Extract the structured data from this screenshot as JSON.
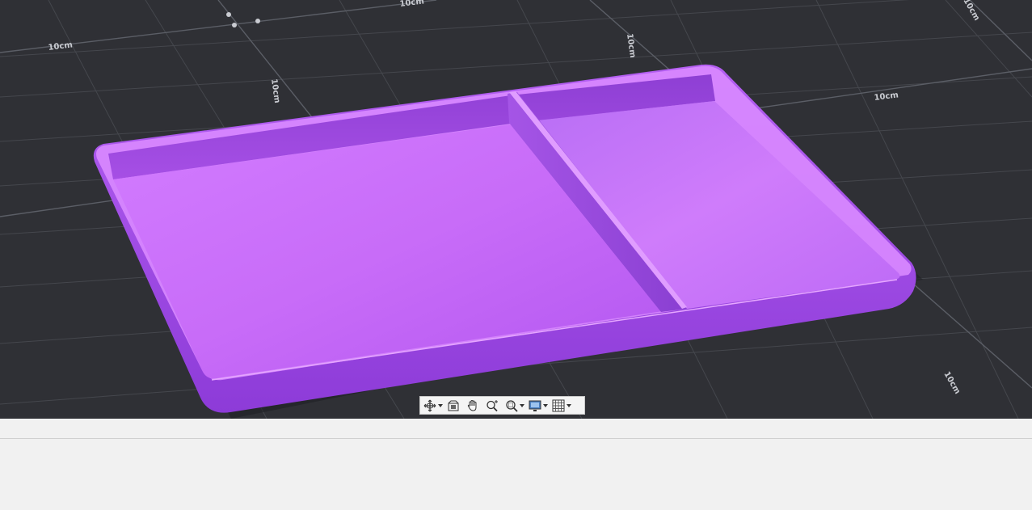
{
  "viewport": {
    "background_color": "#2f3035",
    "grid_color": "#45474d",
    "model_color": "#c868f2",
    "model_description": "two-compartment tray",
    "grid_labels": [
      "10cm",
      "10cm",
      "10cm",
      "10cm",
      "10cm",
      "10cm",
      "10cm"
    ]
  },
  "toolbar": {
    "buttons": [
      {
        "name": "orbit-icon",
        "has_dropdown": true
      },
      {
        "name": "look-at-icon",
        "has_dropdown": false
      },
      {
        "name": "pan-hand-icon",
        "has_dropdown": false
      },
      {
        "name": "zoom-icon",
        "has_dropdown": false
      },
      {
        "name": "zoom-window-icon",
        "has_dropdown": true
      },
      {
        "name": "display-settings-icon",
        "has_dropdown": true
      },
      {
        "name": "grid-settings-icon",
        "has_dropdown": true
      }
    ]
  }
}
